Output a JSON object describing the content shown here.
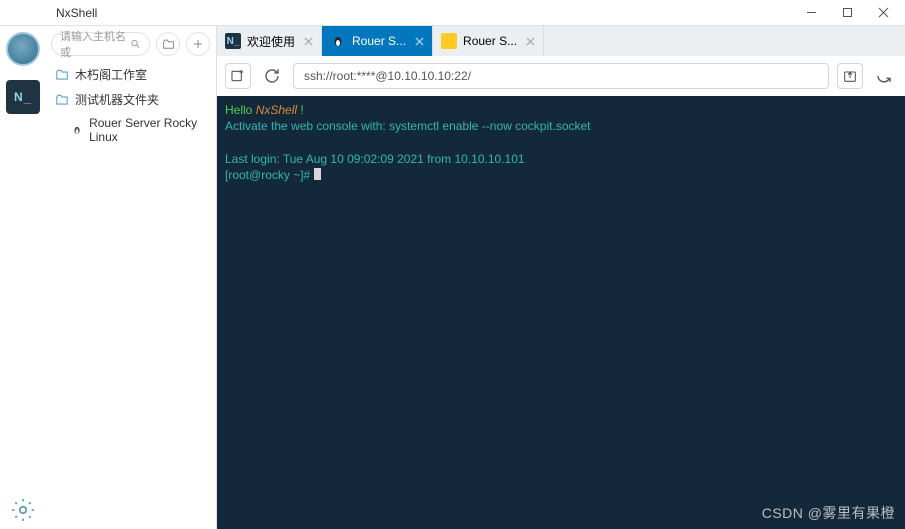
{
  "titlebar": {
    "title": "NxShell"
  },
  "sidebar": {
    "search_placeholder": "请输入主机名或",
    "items": [
      {
        "label": "木朽阁工作室"
      },
      {
        "label": "测试机器文件夹"
      },
      {
        "label": "Rouer Server Rocky Linux"
      }
    ]
  },
  "tabs": [
    {
      "label": "欢迎使用",
      "active": false,
      "icon": "blue-n"
    },
    {
      "label": "Rouer S...",
      "active": true,
      "icon": "penguin"
    },
    {
      "label": "Rouer S...",
      "active": false,
      "icon": "folder"
    }
  ],
  "toolbar": {
    "address": "ssh://root:****@10.10.10.10:22/"
  },
  "terminal": {
    "line1_a": "Hello ",
    "line1_b": "NxShell",
    "line1_c": " !",
    "line2": "Activate the web console with: systemctl enable --now cockpit.socket",
    "line3": "Last login: Tue Aug 10 09:02:09 2021 from 10.10.10.101",
    "prompt": "[root@rocky ~]# "
  },
  "watermark": "CSDN @雾里有果橙"
}
